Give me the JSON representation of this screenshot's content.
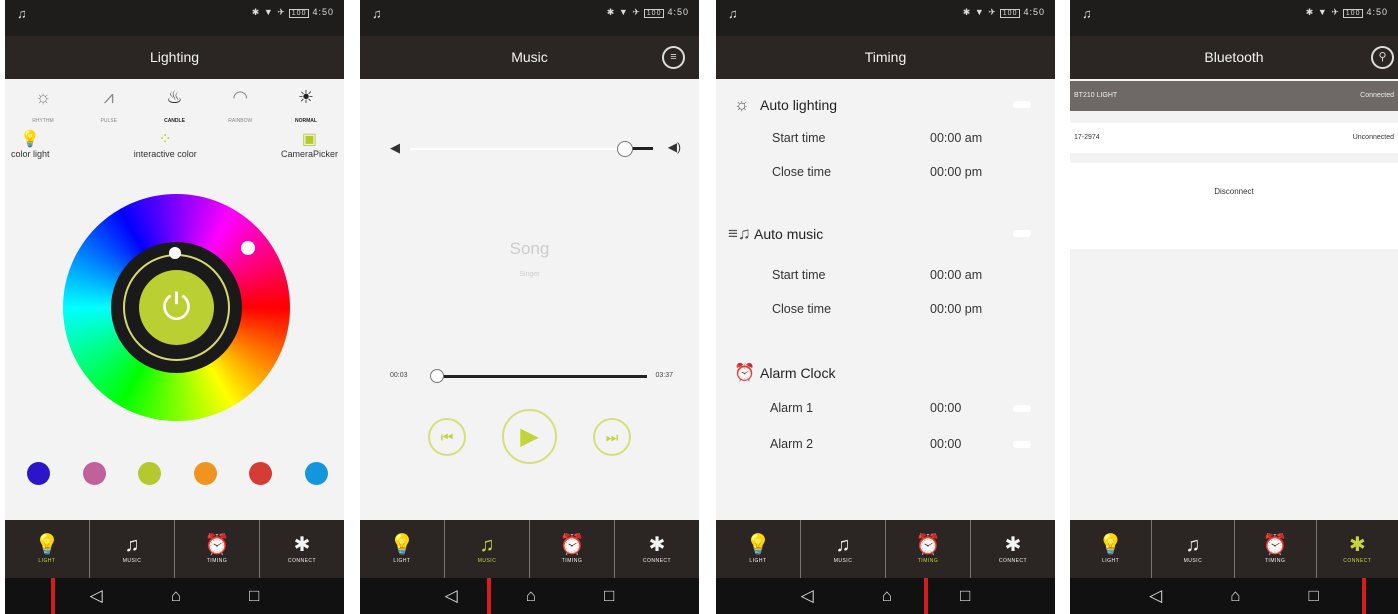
{
  "status": {
    "time": "4:50",
    "icons": "✱ ▼ ✈",
    "battery": "100"
  },
  "tabs": [
    {
      "label": "LIGHT",
      "icon": "bulb-icon",
      "glyph": "💡"
    },
    {
      "label": "MUSIC",
      "icon": "music-note-icon",
      "glyph": "♫"
    },
    {
      "label": "TIMING",
      "icon": "alarm-clock-icon",
      "glyph": "⏰"
    },
    {
      "label": "CONNECT",
      "icon": "bluetooth-icon",
      "glyph": "✱"
    }
  ],
  "nav": {
    "back": "◁",
    "home": "⌂",
    "recent": "□"
  },
  "accent": "#c8d63a",
  "lighting": {
    "title": "Lighting",
    "modes": [
      {
        "label": "RHYTHM",
        "glyph": "☼"
      },
      {
        "label": "PULSE",
        "glyph": "⩘"
      },
      {
        "label": "CANDLE",
        "glyph": "♨"
      },
      {
        "label": "RAINBOW",
        "glyph": "◠"
      },
      {
        "label": "NORMAL",
        "glyph": "☀"
      }
    ],
    "light_modes": [
      {
        "label": "color light",
        "glyph": "💡"
      },
      {
        "label": "interactive color",
        "glyph": "⁘"
      },
      {
        "label": "CameraPicker",
        "glyph": "▣"
      }
    ],
    "power_glyph": "⏻",
    "swatches": [
      "#2a16c9",
      "#c0619c",
      "#b5c92f",
      "#f09420",
      "#d63b35",
      "#1396dc"
    ]
  },
  "music": {
    "title": "Music",
    "menu_glyph": "≡",
    "volume_level": 0.78,
    "song": "Song",
    "singer": "Singer",
    "current_time": "00:03",
    "total_time": "03:37",
    "progress": 0.01,
    "prev": "⏮",
    "play": "▶",
    "next": "⏭"
  },
  "timing": {
    "title": "Timing",
    "auto_lighting": {
      "label": "Auto lighting",
      "start_label": "Start time",
      "start": "00:00 am",
      "close_label": "Close time",
      "close": "00:00 pm"
    },
    "auto_music": {
      "label": "Auto music",
      "start_label": "Start time",
      "start": "00:00 am",
      "close_label": "Close time",
      "close": "00:00 pm"
    },
    "alarm": {
      "label": "Alarm Clock",
      "a1_label": "Alarm 1",
      "a1": "00:00",
      "a2_label": "Alarm 2",
      "a2": "00:00"
    }
  },
  "bluetooth": {
    "title": "Bluetooth",
    "search_glyph": "⚲",
    "devices": [
      {
        "name": "BT210 LIGHT",
        "status": "Connected"
      },
      {
        "name": "17-2974",
        "status": "Unconnected"
      }
    ],
    "disconnect": "Disconnect"
  }
}
